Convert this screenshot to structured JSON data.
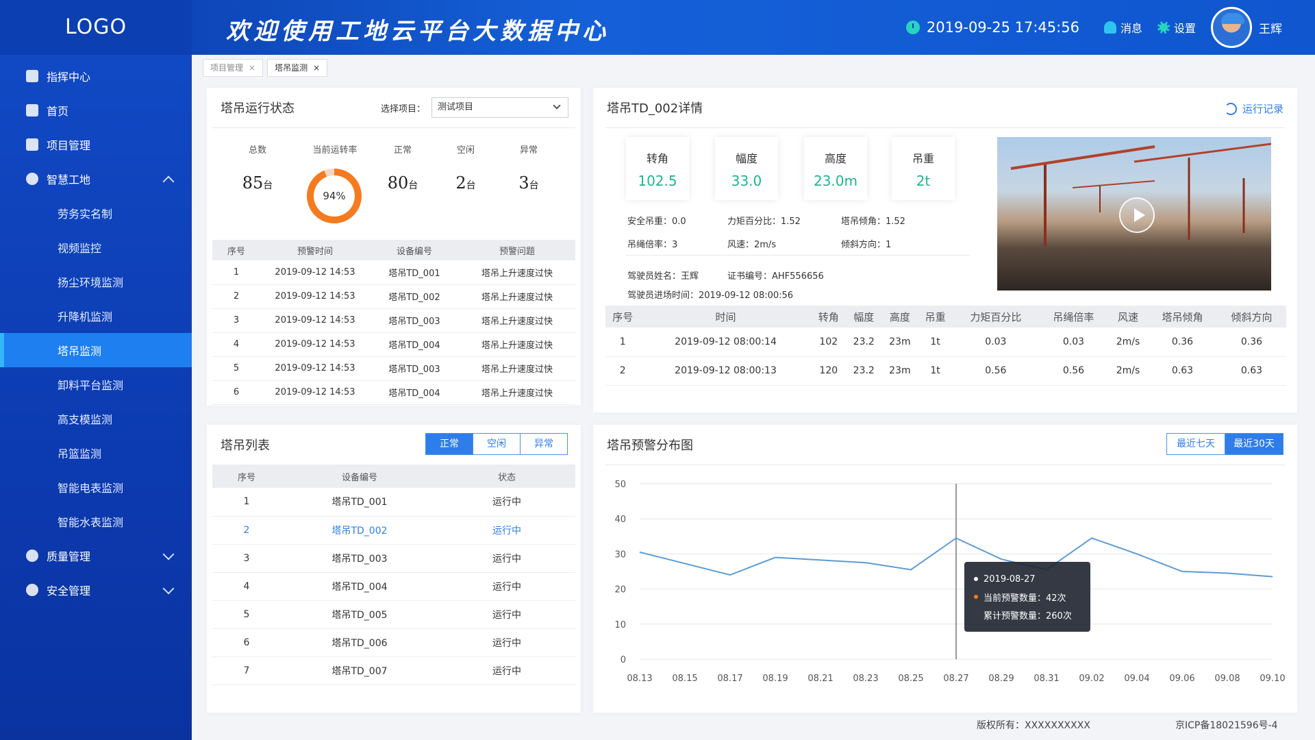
{
  "header": {
    "logo": "LOGO",
    "welcome": "欢迎使用工地云平台大数据中心",
    "datetime": "2019-09-25  17:45:56",
    "messages": "消息",
    "settings": "设置",
    "user": "王辉"
  },
  "sidebar": {
    "items": [
      {
        "label": "指挥中心",
        "type": "top"
      },
      {
        "label": "首页",
        "type": "top"
      },
      {
        "label": "项目管理",
        "type": "top"
      },
      {
        "label": "智慧工地",
        "type": "group-open"
      },
      {
        "label": "劳务实名制",
        "type": "sub"
      },
      {
        "label": "视频监控",
        "type": "sub"
      },
      {
        "label": "扬尘环境监测",
        "type": "sub"
      },
      {
        "label": "升降机监测",
        "type": "sub"
      },
      {
        "label": "塔吊监测",
        "type": "sub-active"
      },
      {
        "label": "卸料平台监测",
        "type": "sub"
      },
      {
        "label": "高支模监测",
        "type": "sub"
      },
      {
        "label": "吊篮监测",
        "type": "sub"
      },
      {
        "label": "智能电表监测",
        "type": "sub"
      },
      {
        "label": "智能水表监测",
        "type": "sub"
      },
      {
        "label": "质量管理",
        "type": "group"
      },
      {
        "label": "安全管理",
        "type": "group"
      }
    ]
  },
  "tabs": [
    {
      "label": "项目管理",
      "close": "×"
    },
    {
      "label": "塔吊监测",
      "close": "×"
    }
  ],
  "status_panel": {
    "title": "塔吊运行状态",
    "select_label": "选择项目：",
    "select_value": "测试项目",
    "stats": {
      "total_label": "总数",
      "total_value": "85",
      "rate_label": "当前运转率",
      "rate_value": "94%",
      "rate_fraction": 0.94,
      "normal_label": "正常",
      "normal_value": "80",
      "idle_label": "空闲",
      "idle_value": "2",
      "abnormal_label": "异常",
      "abnormal_value": "3",
      "unit": "台"
    },
    "columns": [
      "序号",
      "预警时间",
      "设备编号",
      "预警问题"
    ],
    "rows": [
      [
        "1",
        "2019-09-12 14:53",
        "塔吊TD_001",
        "塔吊上升速度过快"
      ],
      [
        "2",
        "2019-09-12 14:53",
        "塔吊TD_002",
        "塔吊上升速度过快"
      ],
      [
        "3",
        "2019-09-12 14:53",
        "塔吊TD_003",
        "塔吊上升速度过快"
      ],
      [
        "4",
        "2019-09-12 14:53",
        "塔吊TD_004",
        "塔吊上升速度过快"
      ],
      [
        "5",
        "2019-09-12 14:53",
        "塔吊TD_003",
        "塔吊上升速度过快"
      ],
      [
        "6",
        "2019-09-12 14:53",
        "塔吊TD_004",
        "塔吊上升速度过快"
      ]
    ]
  },
  "detail_panel": {
    "title": "塔吊TD_002详情",
    "run_record": "运行记录",
    "metrics": [
      {
        "label": "转角",
        "value": "102.5"
      },
      {
        "label": "幅度",
        "value": "33.0"
      },
      {
        "label": "高度",
        "value": "23.0m"
      },
      {
        "label": "吊重",
        "value": "2t"
      }
    ],
    "info": {
      "safe_load": "安全吊重：0.0",
      "torque_pct": "力矩百分比：1.52",
      "tilt": "塔吊倾角：1.52",
      "rope_ratio": "吊绳倍率：3",
      "wind": "风速：2m/s",
      "tilt_dir": "倾斜方向：1",
      "driver": "驾驶员姓名：王辉",
      "cert": "证书编号：AHF556656",
      "entry_time": "驾驶员进场时间：2019-09-12 08:00:56"
    },
    "columns": [
      "序号",
      "时间",
      "转角",
      "幅度",
      "高度",
      "吊重",
      "力矩百分比",
      "吊绳倍率",
      "风速",
      "塔吊倾角",
      "倾斜方向"
    ],
    "rows": [
      [
        "1",
        "2019-09-12 08:00:14",
        "102",
        "23.2",
        "23m",
        "1t",
        "0.03",
        "0.03",
        "2m/s",
        "0.36",
        "0.36"
      ],
      [
        "2",
        "2019-09-12 08:00:13",
        "120",
        "23.2",
        "23m",
        "1t",
        "0.56",
        "0.56",
        "2m/s",
        "0.63",
        "0.63"
      ]
    ]
  },
  "list_panel": {
    "title": "塔吊列表",
    "filters": [
      "正常",
      "空闲",
      "异常"
    ],
    "columns": [
      "序号",
      "设备编号",
      "状态"
    ],
    "rows": [
      [
        "1",
        "塔吊TD_001",
        "运行中"
      ],
      [
        "2",
        "塔吊TD_002",
        "运行中"
      ],
      [
        "3",
        "塔吊TD_003",
        "运行中"
      ],
      [
        "4",
        "塔吊TD_004",
        "运行中"
      ],
      [
        "5",
        "塔吊TD_005",
        "运行中"
      ],
      [
        "6",
        "塔吊TD_006",
        "运行中"
      ],
      [
        "7",
        "塔吊TD_007",
        "运行中"
      ]
    ]
  },
  "chart_panel": {
    "title": "塔吊预警分布图",
    "ranges": [
      "最近七天",
      "最近30天"
    ],
    "tooltip": {
      "date": "2019-08-27",
      "current": "当前预警数量：42次",
      "total": "累计预警数量：260次"
    }
  },
  "chart_data": {
    "type": "line",
    "title": "塔吊预警分布图",
    "x": [
      "08.13",
      "08.15",
      "08.17",
      "08.19",
      "08.21",
      "08.23",
      "08.25",
      "08.27",
      "08.29",
      "08.31",
      "09.02",
      "09.04",
      "09.06",
      "09.08",
      "09.10"
    ],
    "series": [
      {
        "values": [
          30.5,
          24,
          29,
          27.5,
          25.5,
          34.5,
          28.5,
          25.5,
          34.5,
          30,
          25,
          24.5,
          23.5
        ]
      }
    ],
    "series_x_index": [
      0,
      2,
      3,
      5,
      6,
      7,
      8,
      9,
      10,
      11,
      12,
      13,
      14
    ],
    "yticks": [
      "0",
      "10",
      "20",
      "30",
      "40",
      "50"
    ],
    "ylim": [
      0,
      50
    ],
    "grid": true,
    "hover_x": "08.27",
    "colors": {
      "line": "#5b9bd5",
      "grid": "#e3e6ec"
    }
  },
  "footer": {
    "copyright": "版权所有：XXXXXXXXXX",
    "icp": "京ICP备18021596号-4"
  },
  "colors": {
    "accent": "#2f7de8",
    "metric": "#1fb58f",
    "donut": "#f47b20"
  }
}
